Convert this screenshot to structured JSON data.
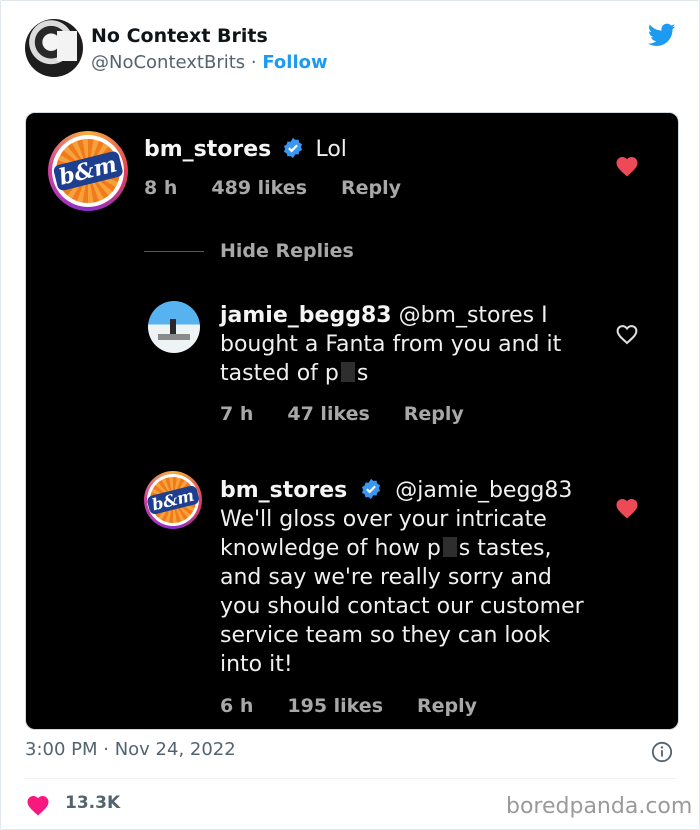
{
  "tweet": {
    "display_name": "No Context Brits",
    "handle": "@NoContextBrits",
    "separator": " · ",
    "follow_label": "Follow",
    "timestamp": "3:00 PM · Nov 24, 2022",
    "likes": "13.3K"
  },
  "screenshot": {
    "top_comment": {
      "username": "bm_stores",
      "text": "Lol",
      "age": "8 h",
      "likes": "489 likes",
      "reply_label": "Reply",
      "liked": true
    },
    "hide_replies_label": "Hide Replies",
    "reply1": {
      "username": "jamie_begg83",
      "mention": "@bm_stores",
      "text_line1_tail": " I",
      "text_line2": "bought a Fanta from you and it",
      "text_line3_pre": "tasted of p",
      "text_line3_post": "s",
      "age": "7 h",
      "likes": "47 likes",
      "reply_label": "Reply",
      "liked": false
    },
    "reply2": {
      "username": "bm_stores",
      "mention": "@jamie_begg83",
      "line1": "We'll gloss over your intricate",
      "line2_pre": "knowledge of how p",
      "line2_post": "s tastes,",
      "line3": "and say we're really sorry and",
      "line4": "you should contact our customer",
      "line5": "service team so they can look",
      "line6": "into it!",
      "age": "6 h",
      "likes": "195 likes",
      "reply_label": "Reply",
      "liked": true
    },
    "logo_text": "b&m"
  },
  "watermark": "boredpanda.com",
  "colors": {
    "twitter_blue": "#1d9bf0",
    "like_red": "#f91880",
    "instagram_red": "#ed4956"
  },
  "icons": [
    "twitter-bird-icon",
    "verified-icon",
    "heart-icon",
    "info-icon"
  ]
}
